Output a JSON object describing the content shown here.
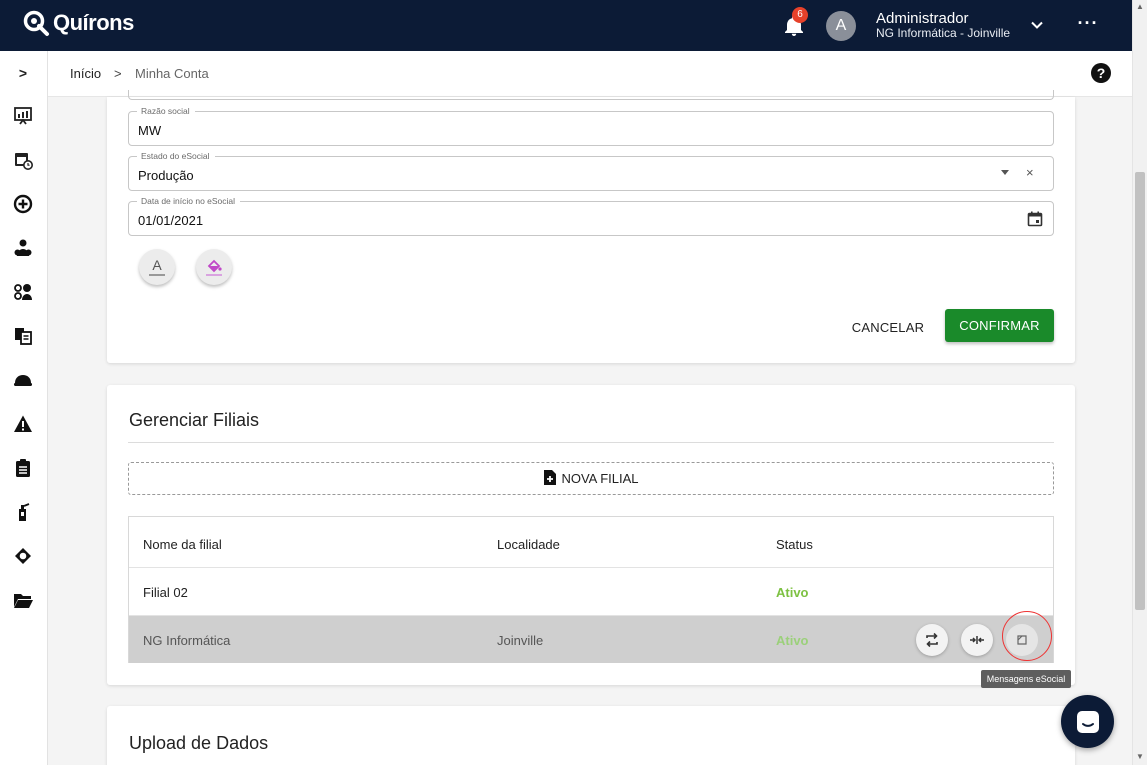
{
  "app": {
    "brand": "Quírons",
    "notifications_count": "6",
    "avatar_letter": "A",
    "user_name": "Administrador",
    "user_org": "NG Informática - Joinville",
    "more_label": "···"
  },
  "breadcrumb": {
    "home": "Início",
    "separator": ">",
    "current": "Minha Conta"
  },
  "sidebar": {
    "expand_label": ">",
    "icons": [
      "chart-presentation-icon",
      "calendar-clock-icon",
      "plus-circle-icon",
      "users-group-icon",
      "user-settings-icon",
      "documents-icon",
      "helmet-icon",
      "warning-icon",
      "clipboard-icon",
      "fire-extinguisher-icon",
      "worker-icon",
      "folder-open-icon"
    ]
  },
  "form": {
    "razao_social": {
      "label": "Razão social",
      "value": "MW"
    },
    "estado_esocial": {
      "label": "Estado do eSocial",
      "value": "Produção",
      "clear": "×"
    },
    "data_inicio": {
      "label": "Data de início no eSocial",
      "value": "01/01/2021"
    },
    "text_color_glyph": "A",
    "cancel_label": "CANCELAR",
    "confirm_label": "CONFIRMAR"
  },
  "filiais": {
    "title": "Gerenciar Filiais",
    "new_label": "NOVA FILIAL",
    "columns": [
      "Nome da filial",
      "Localidade",
      "Status"
    ],
    "rows": [
      {
        "name": "Filial 02",
        "locality": "",
        "status": "Ativo"
      },
      {
        "name": "NG Informática",
        "locality": "Joinville",
        "status": "Ativo"
      }
    ],
    "tooltip": "Mensagens eSocial"
  },
  "upload": {
    "title": "Upload de Dados"
  },
  "colors": {
    "topbar": "#0c1b36",
    "confirm": "#1a8a2a",
    "status_active": "#7dc142",
    "badge": "#e6412a"
  }
}
